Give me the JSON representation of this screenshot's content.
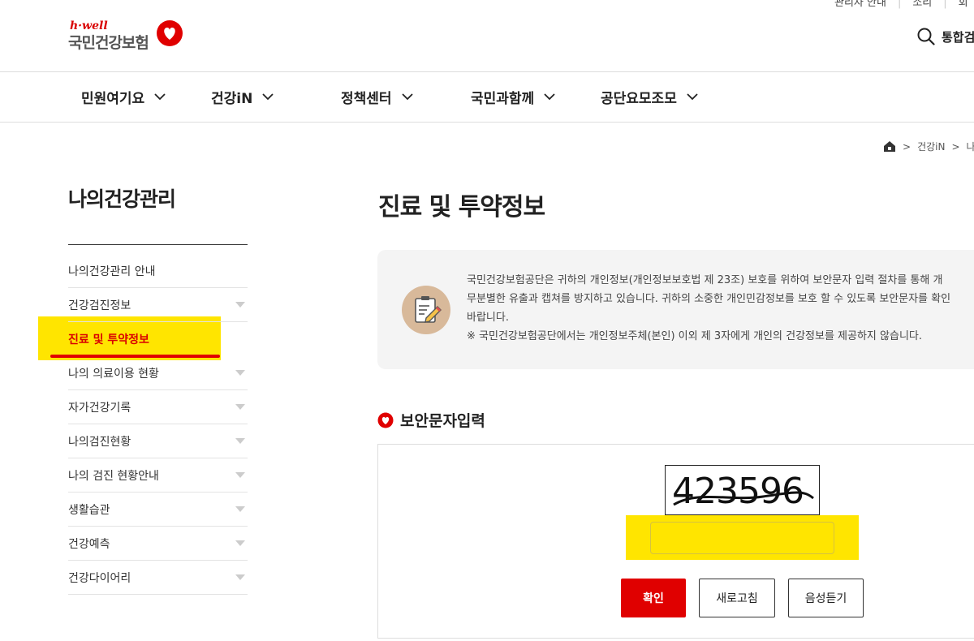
{
  "util": {
    "items": [
      "관리자 안내",
      "소리",
      "회"
    ]
  },
  "logo": {
    "brand": "h·well",
    "name": "국민건강보험"
  },
  "search": {
    "label": "통합검"
  },
  "gnb": [
    {
      "label": "민원여기요"
    },
    {
      "label": "건강iN"
    },
    {
      "label": "정책센터"
    },
    {
      "label": "국민과함께"
    },
    {
      "label": "공단요모조모"
    }
  ],
  "breadcrumb": {
    "items": [
      "건강iN",
      "나"
    ]
  },
  "lnb": {
    "title": "나의건강관리",
    "items": [
      {
        "label": "나의건강관리 안내"
      },
      {
        "label": "건강검진정보"
      },
      {
        "label": "진료 및 투약정보"
      },
      {
        "label": "나의 의료이용 현황"
      },
      {
        "label": "자가건강기록"
      },
      {
        "label": "나의검진현황"
      },
      {
        "label": "나의 검진 현황안내"
      },
      {
        "label": "생활습관"
      },
      {
        "label": "건강예측"
      },
      {
        "label": "건강다이어리"
      }
    ]
  },
  "page": {
    "title": "진료 및 투약정보"
  },
  "notice": {
    "line1": "국민건강보험공단은 귀하의 개인정보(개인정보보호법 제 23조) 보호를 위하여 보안문자 입력 절차를 통해 개",
    "line2": "무분별한 유출과 캡쳐를 방지하고 있습니다. 귀하의 소중한 개인민감정보를 보호 할 수 있도록 보안문자를 확인",
    "line3": "바랍니다.",
    "line4": "※ 국민건강보험공단에서는 개인정보주체(본인) 이외 제 3자에게 개인의 건강정보를 제공하지 않습니다."
  },
  "security": {
    "title": "보안문자입력",
    "captcha_text": "423596",
    "input_value": "",
    "confirm_label": "확인",
    "refresh_label": "새로고침",
    "voice_label": "음성듣기"
  },
  "colors": {
    "brand_red": "#e00000",
    "highlight": "#ffe500"
  }
}
